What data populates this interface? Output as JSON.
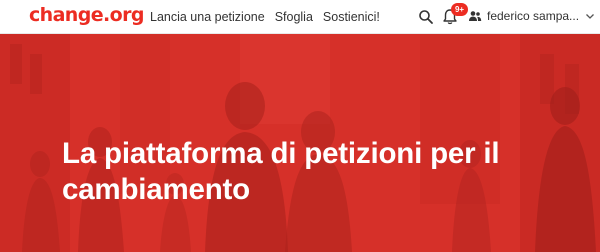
{
  "brand": {
    "logo_text": "change.org",
    "accent_color": "#ec2c22"
  },
  "nav": {
    "links": [
      "Lancia una petizione",
      "Sfoglia",
      "Sostienici!"
    ]
  },
  "header": {
    "search_icon": "search-icon",
    "notifications": {
      "icon": "bell-icon",
      "badge": "9+"
    },
    "user": {
      "name": "federico sampa...",
      "icon": "users-icon",
      "dropdown_icon": "chevron-down-icon"
    }
  },
  "hero": {
    "title_line1": "La piattaforma di petizioni per il",
    "title_line2": "cambiamento",
    "overlay_color": "#d8302b"
  }
}
